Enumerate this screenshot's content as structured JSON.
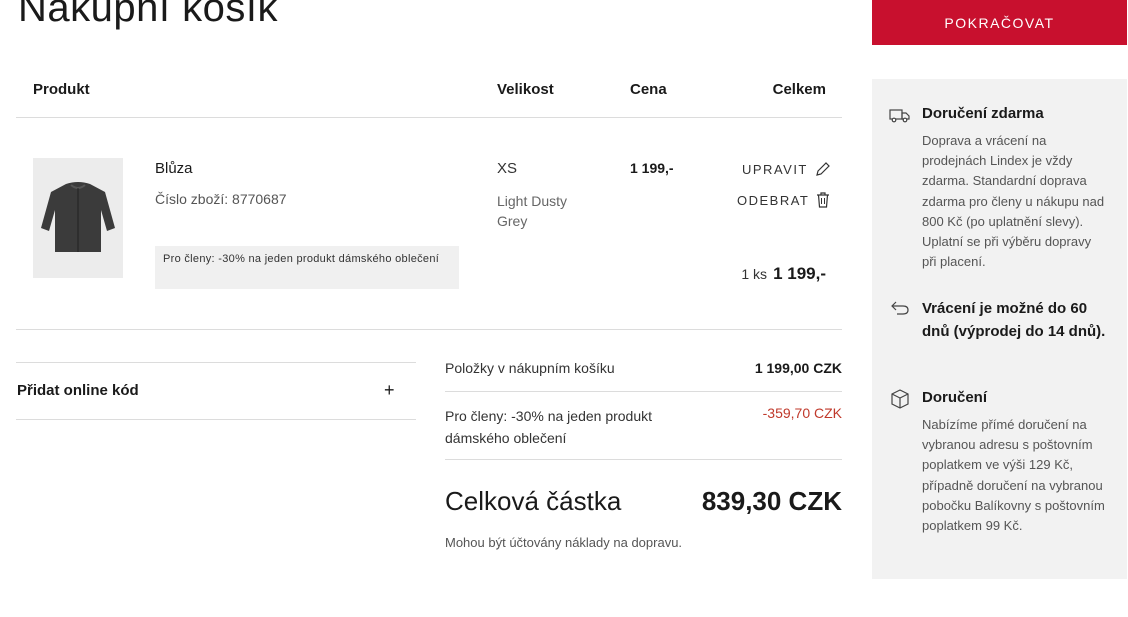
{
  "page": {
    "title": "Nákupní košík"
  },
  "cta": {
    "label": "POKRAČOVAT"
  },
  "table": {
    "headers": {
      "product": "Produkt",
      "size": "Velikost",
      "price": "Cena",
      "total": "Celkem"
    }
  },
  "item": {
    "name": "Blůza",
    "sku": "Číslo zboží: 8770687",
    "promo": "Pro členy: -30% na jeden produkt dámského oblečení",
    "size": "XS",
    "color": "Light Dusty Grey",
    "price": "1 199,-",
    "edit_label": "UPRAVIT",
    "remove_label": "ODEBRAT",
    "qty": "1 ks",
    "line_total": "1 199,-"
  },
  "discount_code": {
    "label": "Přidat online kód",
    "toggle": "+"
  },
  "summary": {
    "items_label": "Položky v nákupním košíku",
    "items_value": "1 199,00 CZK",
    "discount_label": "Pro členy: -30% na jeden produkt dámského oblečení",
    "discount_value": "-359,70 CZK",
    "total_label": "Celková částka",
    "total_value": "839,30 CZK",
    "note": "Mohou být účtovány náklady na dopravu."
  },
  "sidebar": {
    "delivery_free": {
      "icon": "truck-icon",
      "heading": "Doručení zdarma",
      "text": "Doprava a vrácení na prodejnách Lindex je vždy zdarma. Standardní doprava zdarma pro členy u nákupu nad 800 Kč (po uplatnění slevy). Uplatní se při výběru dopravy při placení."
    },
    "returns": {
      "icon": "return-arrow-icon",
      "heading": "Vrácení je možné do 60 dnů (výprodej do 14 dnů)."
    },
    "delivery": {
      "icon": "box-icon",
      "heading": "Doručení",
      "text": "Nabízíme přímé doručení na vybranou adresu s poštovním poplatkem ve výši 129 Kč, případně doručení na vybranou pobočku Balíkovny s poštovním poplatkem 99 Kč."
    }
  },
  "colors": {
    "accent": "#c8102e",
    "discount": "#c0392b",
    "panel": "#f2f2f2"
  }
}
